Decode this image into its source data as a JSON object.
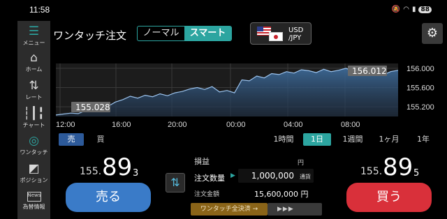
{
  "status_bar": {
    "time": "11:58",
    "battery": "88"
  },
  "sidenav": {
    "items": [
      {
        "label": "メニュー",
        "icon": "hamburger-menu-icon"
      },
      {
        "label": "ホーム",
        "icon": "home-icon"
      },
      {
        "label": "レート",
        "icon": "rate-arrows-icon"
      },
      {
        "label": "チャート",
        "icon": "candlestick-chart-icon"
      },
      {
        "label": "ワンタッチ",
        "icon": "one-touch-icon"
      },
      {
        "label": "ポジション",
        "icon": "position-icon"
      },
      {
        "label": "為替情報",
        "icon": "news-icon"
      }
    ],
    "news_badge": "News"
  },
  "header": {
    "title": "ワンタッチ注文",
    "modes": [
      "ノーマル",
      "スマート"
    ],
    "active_mode": "スマート",
    "pair_top": "USD",
    "pair_bottom": "/JPY"
  },
  "chart": {
    "current_label": "156.012",
    "low_label": "155.028"
  },
  "chart_data": {
    "type": "area",
    "x_ticks": [
      "12:00",
      "16:00",
      "20:00",
      "00:00",
      "04:00",
      "08:00"
    ],
    "y_ticks": [
      "156.000",
      "155.600",
      "155.200"
    ],
    "ylim": [
      155.0,
      156.1
    ],
    "x": [
      0,
      0.5,
      1,
      1.5,
      2,
      2.5,
      3,
      3.5,
      4,
      4.5,
      5,
      5.5,
      6,
      6.5,
      7,
      7.5,
      8,
      8.5,
      9,
      9.5,
      10,
      10.5,
      11,
      11.5,
      12,
      12.5,
      13,
      13.5,
      14,
      14.5,
      15,
      15.5,
      16,
      16.5,
      17,
      17.5,
      18,
      18.5,
      19,
      19.5,
      20,
      20.5,
      21,
      21.5,
      22,
      22.5,
      23
    ],
    "values": [
      155.03,
      155.05,
      155.07,
      155.06,
      155.12,
      155.2,
      155.26,
      155.21,
      155.3,
      155.35,
      155.42,
      155.38,
      155.44,
      155.41,
      155.47,
      155.43,
      155.49,
      155.52,
      155.57,
      155.6,
      155.56,
      155.62,
      155.51,
      155.54,
      155.49,
      155.76,
      155.74,
      155.84,
      155.8,
      155.89,
      155.87,
      155.93,
      155.9,
      155.97,
      155.95,
      155.91,
      155.98,
      155.93,
      155.96,
      156.0,
      155.94,
      155.98,
      156.01,
      156.0,
      155.86,
      155.93,
      155.96
    ],
    "grid": true
  },
  "side_tabs": {
    "sell": "売",
    "buy": "買"
  },
  "periods": [
    "1時間",
    "1日",
    "1週間",
    "1ヶ月",
    "1年"
  ],
  "active_period": "1日",
  "sell_price": {
    "prefix": "155.",
    "main": "89",
    "tail": "3"
  },
  "buy_price": {
    "prefix": "155.",
    "main": "89",
    "tail": "5"
  },
  "order": {
    "pl_label": "損益",
    "pl_unit": "円",
    "qty_label": "注文数量",
    "qty_value": "1,000,000",
    "qty_unit": "通貨",
    "amount_label": "注文金額",
    "amount_value": "15,600,000 円",
    "oneclick_label": "ワンタッチ全決済 →",
    "slide_hint": "▶▶▶"
  },
  "sell_button": "売る",
  "buy_button": "買う",
  "colors": {
    "accent": "#2ca5a0",
    "sell": "#3a7bc8",
    "buy": "#d9303a"
  }
}
